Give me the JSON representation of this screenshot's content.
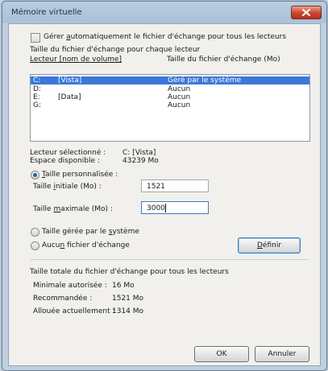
{
  "window": {
    "title": "Mémoire virtuelle"
  },
  "auto_manage": {
    "checked": false,
    "label_pre": "Gérer ",
    "label_u": "a",
    "label_post": "utomatiquement le fichier d'échange pour tous les lecteurs"
  },
  "per_drive_heading": "Taille du fichier d'échange pour chaque lecteur",
  "list": {
    "col_drive": "Lecteur [nom de volume]",
    "col_size": "Taille du fichier d'échange (Mo)",
    "rows": [
      {
        "drive": "C:",
        "volume": "[Vista]",
        "size": "Géré par le système",
        "selected": true
      },
      {
        "drive": "D:",
        "volume": "",
        "size": "Aucun",
        "selected": false
      },
      {
        "drive": "E:",
        "volume": "[Data]",
        "size": "Aucun",
        "selected": false
      },
      {
        "drive": "G:",
        "volume": "",
        "size": "Aucun",
        "selected": false
      }
    ]
  },
  "selected_info": {
    "drive_label": "Lecteur sélectionné :",
    "drive_value": "C:  [Vista]",
    "space_label": "Espace disponible :",
    "space_value": "43239 Mo"
  },
  "custom_size": {
    "label_pre": "",
    "label_u": "T",
    "label_post": "aille personnalisée :",
    "selected": true,
    "initial_label_pre": "Taille ",
    "initial_label_u": "i",
    "initial_label_post": "nitiale (Mo) :",
    "initial_value": "1521",
    "max_label_pre": "Taille ",
    "max_label_u": "m",
    "max_label_post": "aximale (Mo) :",
    "max_value": "3000"
  },
  "system_managed": {
    "label_pre": "Taille gérée par le ",
    "label_u": "s",
    "label_post": "ystème",
    "selected": false
  },
  "no_paging": {
    "label_pre": "Aucu",
    "label_u": "n",
    "label_post": " fichier d'échange",
    "selected": false
  },
  "set_button": {
    "label_pre": "",
    "label_u": "D",
    "label_post": "éfinir"
  },
  "totals": {
    "heading": "Taille totale du fichier d'échange pour tous les lecteurs",
    "min_label": "Minimale autorisée :",
    "min_value": "16 Mo",
    "rec_label": "Recommandée :",
    "rec_value": "1521 Mo",
    "alloc_label": "Allouée actuellement :",
    "alloc_value": "1314 Mo"
  },
  "buttons": {
    "ok": "OK",
    "cancel": "Annuler"
  }
}
